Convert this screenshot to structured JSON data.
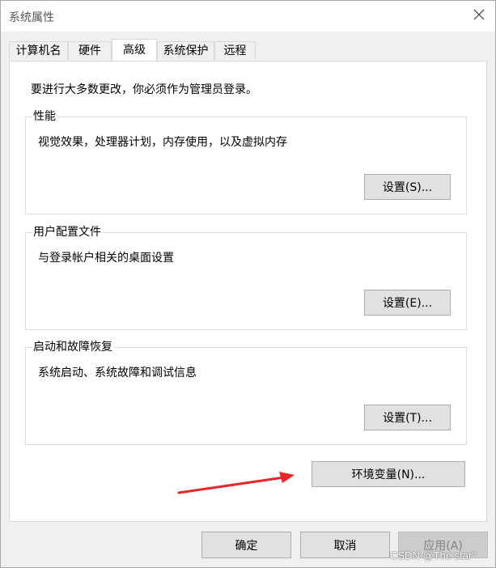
{
  "window": {
    "title": "系统属性"
  },
  "tabs": [
    {
      "label": "计算机名",
      "active": false
    },
    {
      "label": "硬件",
      "active": false
    },
    {
      "label": "高级",
      "active": true
    },
    {
      "label": "系统保护",
      "active": false
    },
    {
      "label": "远程",
      "active": false
    }
  ],
  "notice": "要进行大多数更改，你必须作为管理员登录。",
  "groups": {
    "performance": {
      "title": "性能",
      "desc": "视觉效果，处理器计划，内存使用，以及虚拟内存",
      "button": "设置(S)..."
    },
    "profiles": {
      "title": "用户配置文件",
      "desc": "与登录帐户相关的桌面设置",
      "button": "设置(E)..."
    },
    "startup": {
      "title": "启动和故障恢复",
      "desc": "系统启动、系统故障和调试信息",
      "button": "设置(T)..."
    }
  },
  "env_button": "环境变量(N)...",
  "footer": {
    "ok": "确定",
    "cancel": "取消",
    "apply": "应用(A)"
  },
  "watermark": "CSDN @The star\"",
  "colors": {
    "arrow": "#e8262a",
    "panel": "#ffffff",
    "dialog": "#f0f0f0",
    "button": "#e1e1e1"
  },
  "icons": {
    "close": "close-icon",
    "arrow": "red-arrow-annotation"
  }
}
